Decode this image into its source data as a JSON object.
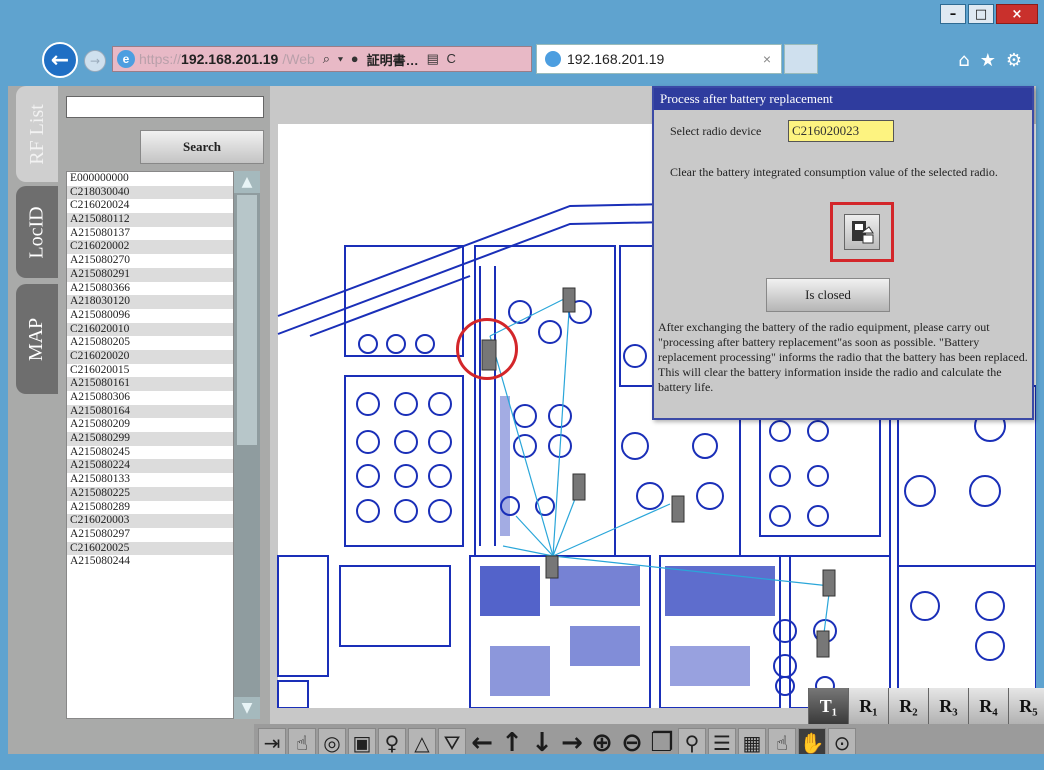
{
  "window": {
    "minimize": "–",
    "maximize": "□",
    "close": "×"
  },
  "browser": {
    "url_scheme": "https://",
    "url_host": "192.168.201.19",
    "url_rest": "/Web",
    "url_icons": "⌕ ▾ ●",
    "cert_label": "証明書…",
    "url_tail_icons": "▤ C",
    "tab_title": "192.168.201.19",
    "tab_close": "×",
    "toolbar_icons": [
      "⌂",
      "★",
      "⚙"
    ]
  },
  "side_tabs": [
    "RF List",
    "LocID",
    "MAP"
  ],
  "search": {
    "value": "",
    "button_label": "Search"
  },
  "id_list": [
    "E000000000",
    "C218030040",
    "C216020024",
    "A215080112",
    "A215080137",
    "C216020002",
    "A215080270",
    "A215080291",
    "A215080366",
    "A218030120",
    "A215080096",
    "C216020010",
    "A215080205",
    "C216020020",
    "C216020015",
    "A215080161",
    "A215080306",
    "A215080164",
    "A215080209",
    "A215080299",
    "A215080245",
    "A215080224",
    "A215080133",
    "A215080225",
    "A215080289",
    "C216020003",
    "A215080297",
    "C216020025",
    "A215080244"
  ],
  "dialog": {
    "title": "Process after battery replacement",
    "select_label": "Select  radio device",
    "select_value": "C216020023",
    "clear_text": "Clear the battery integrated consumption value of the selected radio.",
    "closed_button": "Is closed",
    "note": "After exchanging the battery of the radio equipment, please carry out \"processing after battery replacement\"as soon as possible. \"Battery replacement processing\" informs the radio that the battery has been replaced. This will clear the battery information inside the radio and calculate the battery life."
  },
  "tr_toolbar": [
    "T₁",
    "R₁",
    "R₂",
    "R₃",
    "R₄",
    "R₅"
  ],
  "bottom_toolbar": {
    "exit": "⇥",
    "pointer": "☝",
    "rotate": "◎",
    "card": "▣",
    "bulb": "♀",
    "bell": "△",
    "antenna": "⛛",
    "left": "←",
    "up": "↑",
    "down": "↓",
    "right": "→",
    "zoom_in": "⊕",
    "zoom_out": "⊖",
    "window": "❐",
    "tree": "⚲",
    "list1": "☰",
    "list2": "▦",
    "hand1": "☝",
    "hand2": "✋",
    "fit": "⊙"
  }
}
